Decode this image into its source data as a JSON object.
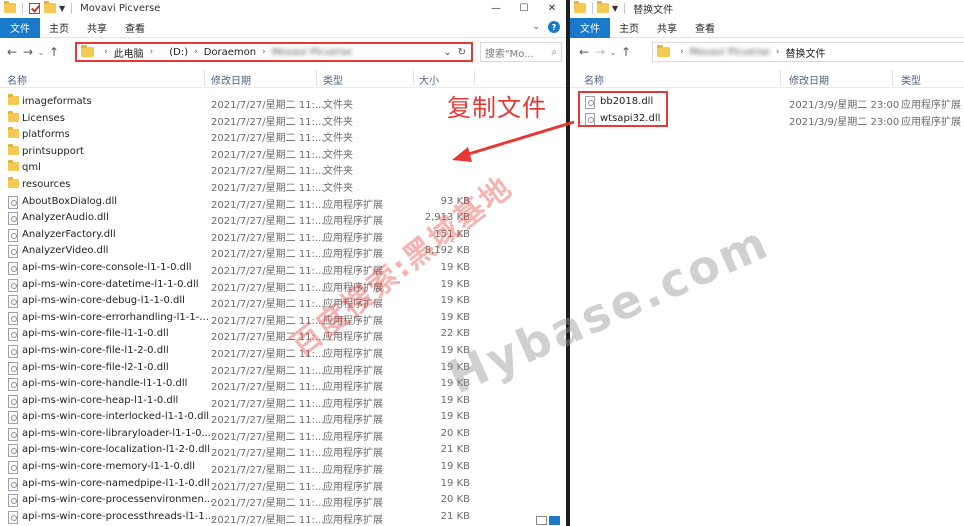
{
  "left_window": {
    "title": "Movavi Picverse",
    "tabs": [
      "文件",
      "主页",
      "共享",
      "查看"
    ],
    "breadcrumbs": [
      "此电脑",
      "(D:)",
      "Doraemon",
      "Movavi Picverse"
    ],
    "search_placeholder": "搜索\"Mo...",
    "columns": [
      "名称",
      "修改日期",
      "类型",
      "大小"
    ],
    "files": [
      {
        "name": "imageformats",
        "date": "2021/7/27/星期二 11:...",
        "type": "文件夹",
        "size": "",
        "kind": "folder"
      },
      {
        "name": "Licenses",
        "date": "2021/7/27/星期二 11:...",
        "type": "文件夹",
        "size": "",
        "kind": "folder"
      },
      {
        "name": "platforms",
        "date": "2021/7/27/星期二 11:...",
        "type": "文件夹",
        "size": "",
        "kind": "folder"
      },
      {
        "name": "printsupport",
        "date": "2021/7/27/星期二 11:...",
        "type": "文件夹",
        "size": "",
        "kind": "folder"
      },
      {
        "name": "qml",
        "date": "2021/7/27/星期二 11:...",
        "type": "文件夹",
        "size": "",
        "kind": "folder"
      },
      {
        "name": "resources",
        "date": "2021/7/27/星期二 11:...",
        "type": "文件夹",
        "size": "",
        "kind": "folder"
      },
      {
        "name": "AboutBoxDialog.dll",
        "date": "2021/7/27/星期二 11:...",
        "type": "应用程序扩展",
        "size": "93 KB",
        "kind": "file"
      },
      {
        "name": "AnalyzerAudio.dll",
        "date": "2021/7/27/星期二 11:...",
        "type": "应用程序扩展",
        "size": "2,913 KB",
        "kind": "file"
      },
      {
        "name": "AnalyzerFactory.dll",
        "date": "2021/7/27/星期二 11:...",
        "type": "应用程序扩展",
        "size": "151 KB",
        "kind": "file"
      },
      {
        "name": "AnalyzerVideo.dll",
        "date": "2021/7/27/星期二 11:...",
        "type": "应用程序扩展",
        "size": "8,192 KB",
        "kind": "file"
      },
      {
        "name": "api-ms-win-core-console-l1-1-0.dll",
        "date": "2021/7/27/星期二 11:...",
        "type": "应用程序扩展",
        "size": "19 KB",
        "kind": "file"
      },
      {
        "name": "api-ms-win-core-datetime-l1-1-0.dll",
        "date": "2021/7/27/星期二 11:...",
        "type": "应用程序扩展",
        "size": "19 KB",
        "kind": "file"
      },
      {
        "name": "api-ms-win-core-debug-l1-1-0.dll",
        "date": "2021/7/27/星期二 11:...",
        "type": "应用程序扩展",
        "size": "19 KB",
        "kind": "file"
      },
      {
        "name": "api-ms-win-core-errorhandling-l1-1-...",
        "date": "2021/7/27/星期二 11:...",
        "type": "应用程序扩展",
        "size": "19 KB",
        "kind": "file"
      },
      {
        "name": "api-ms-win-core-file-l1-1-0.dll",
        "date": "2021/7/27/星期二 11:...",
        "type": "应用程序扩展",
        "size": "22 KB",
        "kind": "file"
      },
      {
        "name": "api-ms-win-core-file-l1-2-0.dll",
        "date": "2021/7/27/星期二 11:...",
        "type": "应用程序扩展",
        "size": "19 KB",
        "kind": "file"
      },
      {
        "name": "api-ms-win-core-file-l2-1-0.dll",
        "date": "2021/7/27/星期二 11:...",
        "type": "应用程序扩展",
        "size": "19 KB",
        "kind": "file"
      },
      {
        "name": "api-ms-win-core-handle-l1-1-0.dll",
        "date": "2021/7/27/星期二 11:...",
        "type": "应用程序扩展",
        "size": "19 KB",
        "kind": "file"
      },
      {
        "name": "api-ms-win-core-heap-l1-1-0.dll",
        "date": "2021/7/27/星期二 11:...",
        "type": "应用程序扩展",
        "size": "19 KB",
        "kind": "file"
      },
      {
        "name": "api-ms-win-core-interlocked-l1-1-0.dll",
        "date": "2021/7/27/星期二 11:...",
        "type": "应用程序扩展",
        "size": "19 KB",
        "kind": "file"
      },
      {
        "name": "api-ms-win-core-libraryloader-l1-1-0....",
        "date": "2021/7/27/星期二 11:...",
        "type": "应用程序扩展",
        "size": "20 KB",
        "kind": "file"
      },
      {
        "name": "api-ms-win-core-localization-l1-2-0.dll",
        "date": "2021/7/27/星期二 11:...",
        "type": "应用程序扩展",
        "size": "21 KB",
        "kind": "file"
      },
      {
        "name": "api-ms-win-core-memory-l1-1-0.dll",
        "date": "2021/7/27/星期二 11:...",
        "type": "应用程序扩展",
        "size": "19 KB",
        "kind": "file"
      },
      {
        "name": "api-ms-win-core-namedpipe-l1-1-0.dll",
        "date": "2021/7/27/星期二 11:...",
        "type": "应用程序扩展",
        "size": "19 KB",
        "kind": "file"
      },
      {
        "name": "api-ms-win-core-processenvironmen...",
        "date": "2021/7/27/星期二 11:...",
        "type": "应用程序扩展",
        "size": "20 KB",
        "kind": "file"
      },
      {
        "name": "api-ms-win-core-processthreads-l1-1...",
        "date": "2021/7/27/星期二 11:...",
        "type": "应用程序扩展",
        "size": "21 KB",
        "kind": "file"
      }
    ]
  },
  "right_window": {
    "title": "替换文件",
    "tabs": [
      "文件",
      "主页",
      "共享",
      "查看"
    ],
    "breadcrumbs": [
      "Movavi Picverse",
      "替换文件"
    ],
    "columns": [
      "名称",
      "修改日期",
      "类型"
    ],
    "files": [
      {
        "name": "bb2018.dll",
        "date": "2021/3/9/星期二 23:00",
        "type": "应用程序扩展"
      },
      {
        "name": "wtsapi32.dll",
        "date": "2021/3/9/星期二 23:00",
        "type": "应用程序扩展"
      }
    ]
  },
  "annotation": "复制文件",
  "watermark_cn": "百度搜索:黑域基地",
  "watermark_en": "Hybase.com",
  "colors": {
    "accent": "#1979ca",
    "highlight": "#e53935",
    "folder": "#f6c955"
  }
}
